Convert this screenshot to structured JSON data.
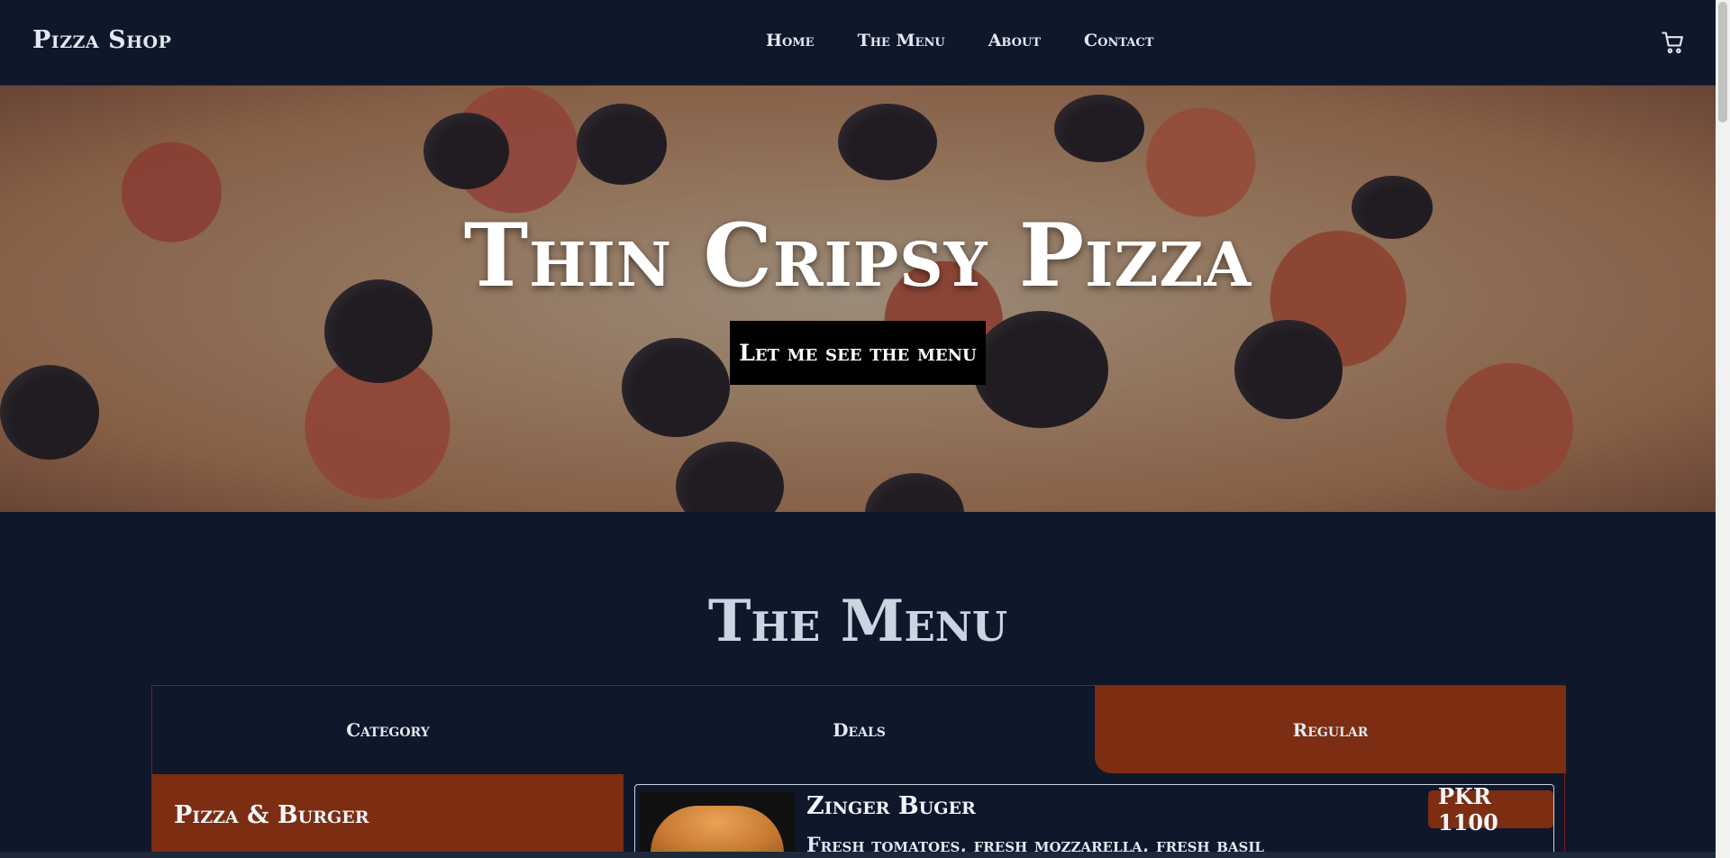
{
  "navbar": {
    "brand": "Pizza Shop",
    "links": [
      "Home",
      "The Menu",
      "About",
      "Contact"
    ],
    "cart_icon": "cart-icon"
  },
  "hero": {
    "title": "Thin Cripsy Pizza",
    "button_label": "Let me see the menu"
  },
  "menu": {
    "heading": "The Menu",
    "tabs": [
      "Category",
      "Deals",
      "Regular"
    ],
    "active_tab": "Regular",
    "categories": [
      "Pizza & Burger"
    ],
    "items": [
      {
        "name": "Zinger Buger",
        "description": "Fresh tomatoes, fresh mozzarella, fresh basil",
        "price": "PKR 1100"
      }
    ]
  },
  "colors": {
    "background": "#0f172a",
    "accent": "#7c2d12"
  }
}
